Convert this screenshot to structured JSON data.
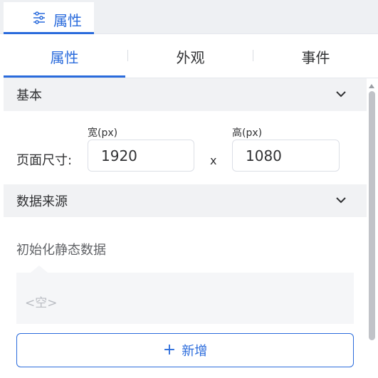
{
  "top_tab": {
    "label": "属性",
    "icon": "sliders-icon"
  },
  "subtabs": [
    "属性",
    "外观",
    "事件"
  ],
  "sections": {
    "basic": {
      "title": "基本"
    },
    "data_source": {
      "title": "数据来源"
    }
  },
  "page_size": {
    "label": "页面尺寸:",
    "width_label": "宽(px)",
    "height_label": "高(px)",
    "width_value": "1920",
    "height_value": "1080",
    "separator": "x"
  },
  "static_data": {
    "label": "初始化静态数据",
    "empty": "<空>"
  },
  "add_button": {
    "plus": "+",
    "label": "新增"
  },
  "colors": {
    "accent": "#2a6bdc",
    "header_bg": "#f1f2f4",
    "strip_bg": "#eef0f3"
  }
}
